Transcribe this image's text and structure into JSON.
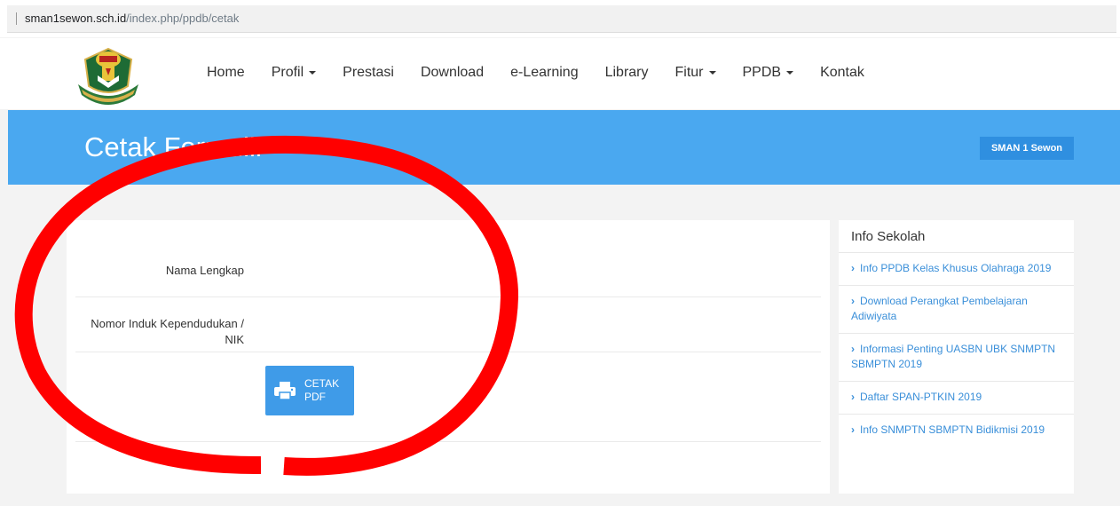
{
  "browser": {
    "host": "sman1sewon.sch.id",
    "path": "/index.php/ppdb/cetak"
  },
  "nav": {
    "items": [
      {
        "label": "Home",
        "dropdown": false
      },
      {
        "label": "Profil",
        "dropdown": true
      },
      {
        "label": "Prestasi",
        "dropdown": false
      },
      {
        "label": "Download",
        "dropdown": false
      },
      {
        "label": "e-Learning",
        "dropdown": false
      },
      {
        "label": "Library",
        "dropdown": false
      },
      {
        "label": "Fitur",
        "dropdown": true
      },
      {
        "label": "PPDB",
        "dropdown": true
      },
      {
        "label": "Kontak",
        "dropdown": false
      }
    ]
  },
  "hero": {
    "title": "Cetak Formulir",
    "badge": "SMAN 1 Sewon"
  },
  "form": {
    "name_label": "Nama Lengkap",
    "nik_label_line1": "Nomor Induk Kependudukan /",
    "nik_label_line2": "NIK",
    "button_line1": "CETAK",
    "button_line2": "PDF"
  },
  "sidebar": {
    "title": "Info Sekolah",
    "items": [
      "Info PPDB Kelas Khusus Olahraga 2019",
      "Download Perangkat Pembelajaran Adiwiyata",
      "Informasi Penting UASBN UBK SNMPTN SBMPTN 2019",
      "Daftar SPAN-PTKIN 2019",
      "Info SNMPTN SBMPTN Bidikmisi 2019"
    ]
  },
  "colors": {
    "hero_blue": "#4aa8f0",
    "button_blue": "#3f9be8",
    "link_blue": "#3a8fd9",
    "annotation_red": "#ff0000"
  },
  "icons": {
    "button": "print-icon",
    "sidebar_bullet": "chevron-right-icon"
  }
}
